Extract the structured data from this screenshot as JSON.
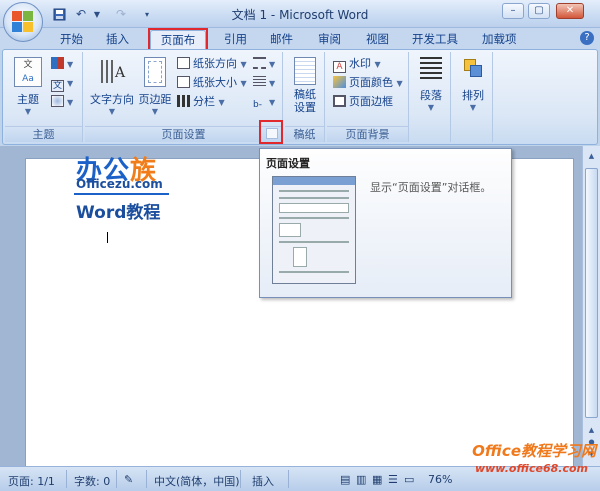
{
  "title": "文档 1 - Microsoft Word",
  "tabs": [
    "开始",
    "插入",
    "页面布局",
    "引用",
    "邮件",
    "审阅",
    "视图",
    "开发工具",
    "加载项"
  ],
  "active_tab_index": 2,
  "ribbon": {
    "theme": {
      "label": "主题",
      "group": "主题"
    },
    "page_setup": {
      "group": "页面设置",
      "text_direction": "文字方向",
      "margins": "页边距",
      "orientation": "纸张方向",
      "size": "纸张大小",
      "columns": "分栏"
    },
    "manuscript": {
      "button": "稿纸\n设置",
      "line1": "稿纸",
      "line2": "设置",
      "group": "稿纸"
    },
    "background": {
      "group": "页面背景",
      "watermark": "水印",
      "page_color": "页面颜色",
      "page_border": "页面边框"
    },
    "paragraph": {
      "label": "段落"
    },
    "arrange": {
      "label": "排列"
    }
  },
  "tooltip": {
    "title": "页面设置",
    "description": "显示“页面设置”对话框。"
  },
  "watermark": {
    "logo_a": "办公",
    "logo_b": "族",
    "site": "Officezu.com",
    "caption": "Word教程",
    "bottom_right": "Office教程学习网",
    "bottom_right_url": "www.office68.com"
  },
  "status": {
    "page": "页面: 1/1",
    "words": "字数: 0",
    "language": "中文(简体，中国)",
    "mode": "插入",
    "zoom": "76%"
  },
  "colors": {
    "accent": "#15428b",
    "highlight": "#e0282d"
  }
}
